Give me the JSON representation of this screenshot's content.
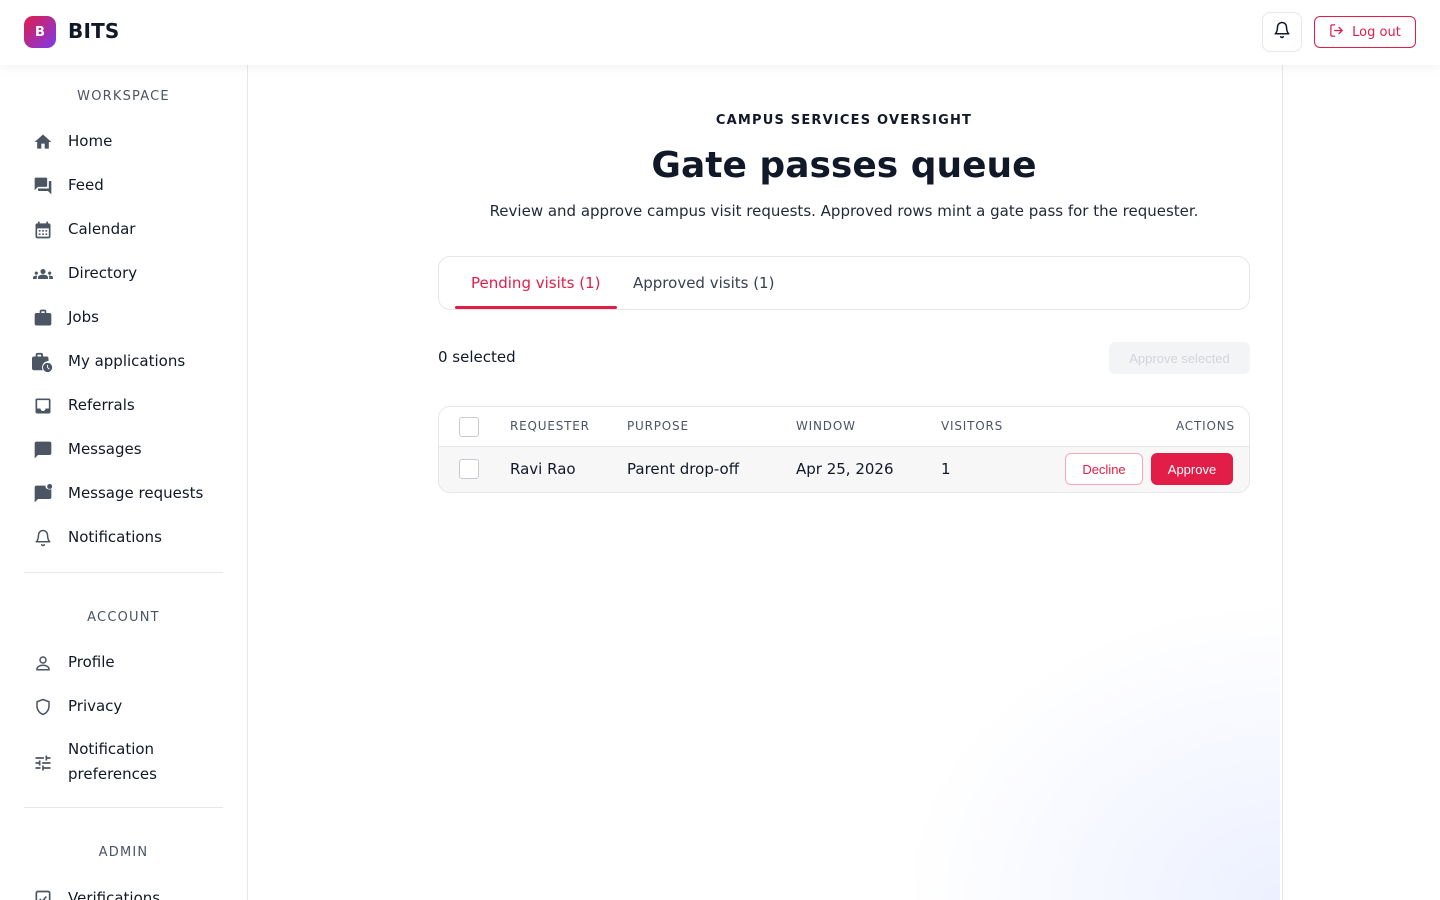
{
  "app": {
    "logo_letter": "B",
    "brand": "BITS",
    "logout_label": "Log out"
  },
  "sidebar": {
    "workspace_title": "WORKSPACE",
    "workspace_items": [
      {
        "label": "Home",
        "icon": "home-icon"
      },
      {
        "label": "Feed",
        "icon": "forum-icon"
      },
      {
        "label": "Calendar",
        "icon": "calendar-icon"
      },
      {
        "label": "Directory",
        "icon": "people-icon"
      },
      {
        "label": "Jobs",
        "icon": "briefcase-icon"
      },
      {
        "label": "My applications",
        "icon": "briefcase-clock-icon"
      },
      {
        "label": "Referrals",
        "icon": "inbox-icon"
      },
      {
        "label": "Messages",
        "icon": "chat-icon"
      },
      {
        "label": "Message requests",
        "icon": "chat-badge-icon"
      },
      {
        "label": "Notifications",
        "icon": "bell-icon"
      }
    ],
    "account_title": "ACCOUNT",
    "account_items": [
      {
        "label": "Profile",
        "icon": "person-icon"
      },
      {
        "label": "Privacy",
        "icon": "shield-icon"
      },
      {
        "label": "Notification preferences",
        "icon": "tune-icon"
      }
    ],
    "admin_title": "ADMIN",
    "admin_items": [
      {
        "label": "Verifications",
        "icon": "verified-icon"
      }
    ]
  },
  "main": {
    "eyebrow": "CAMPUS SERVICES OVERSIGHT",
    "title": "Gate passes queue",
    "subtitle": "Review and approve campus visit requests. Approved rows mint a gate pass for the requester.",
    "tabs": [
      {
        "label": "Pending visits (1)",
        "active": true
      },
      {
        "label": "Approved visits (1)",
        "active": false
      }
    ],
    "selected_count": "0 selected",
    "approve_selected_label": "Approve selected",
    "table": {
      "columns": [
        "REQUESTER",
        "PURPOSE",
        "WINDOW",
        "VISITORS",
        "ACTIONS"
      ],
      "rows": [
        {
          "requester": "Ravi Rao",
          "purpose": "Parent drop-off",
          "window": "Apr 25, 2026",
          "visitors": "1"
        }
      ],
      "decline_label": "Decline",
      "approve_label": "Approve"
    }
  },
  "colors": {
    "accent": "#e11d48",
    "text": "#111827",
    "muted": "#4b5563",
    "border": "#e5e7eb"
  }
}
